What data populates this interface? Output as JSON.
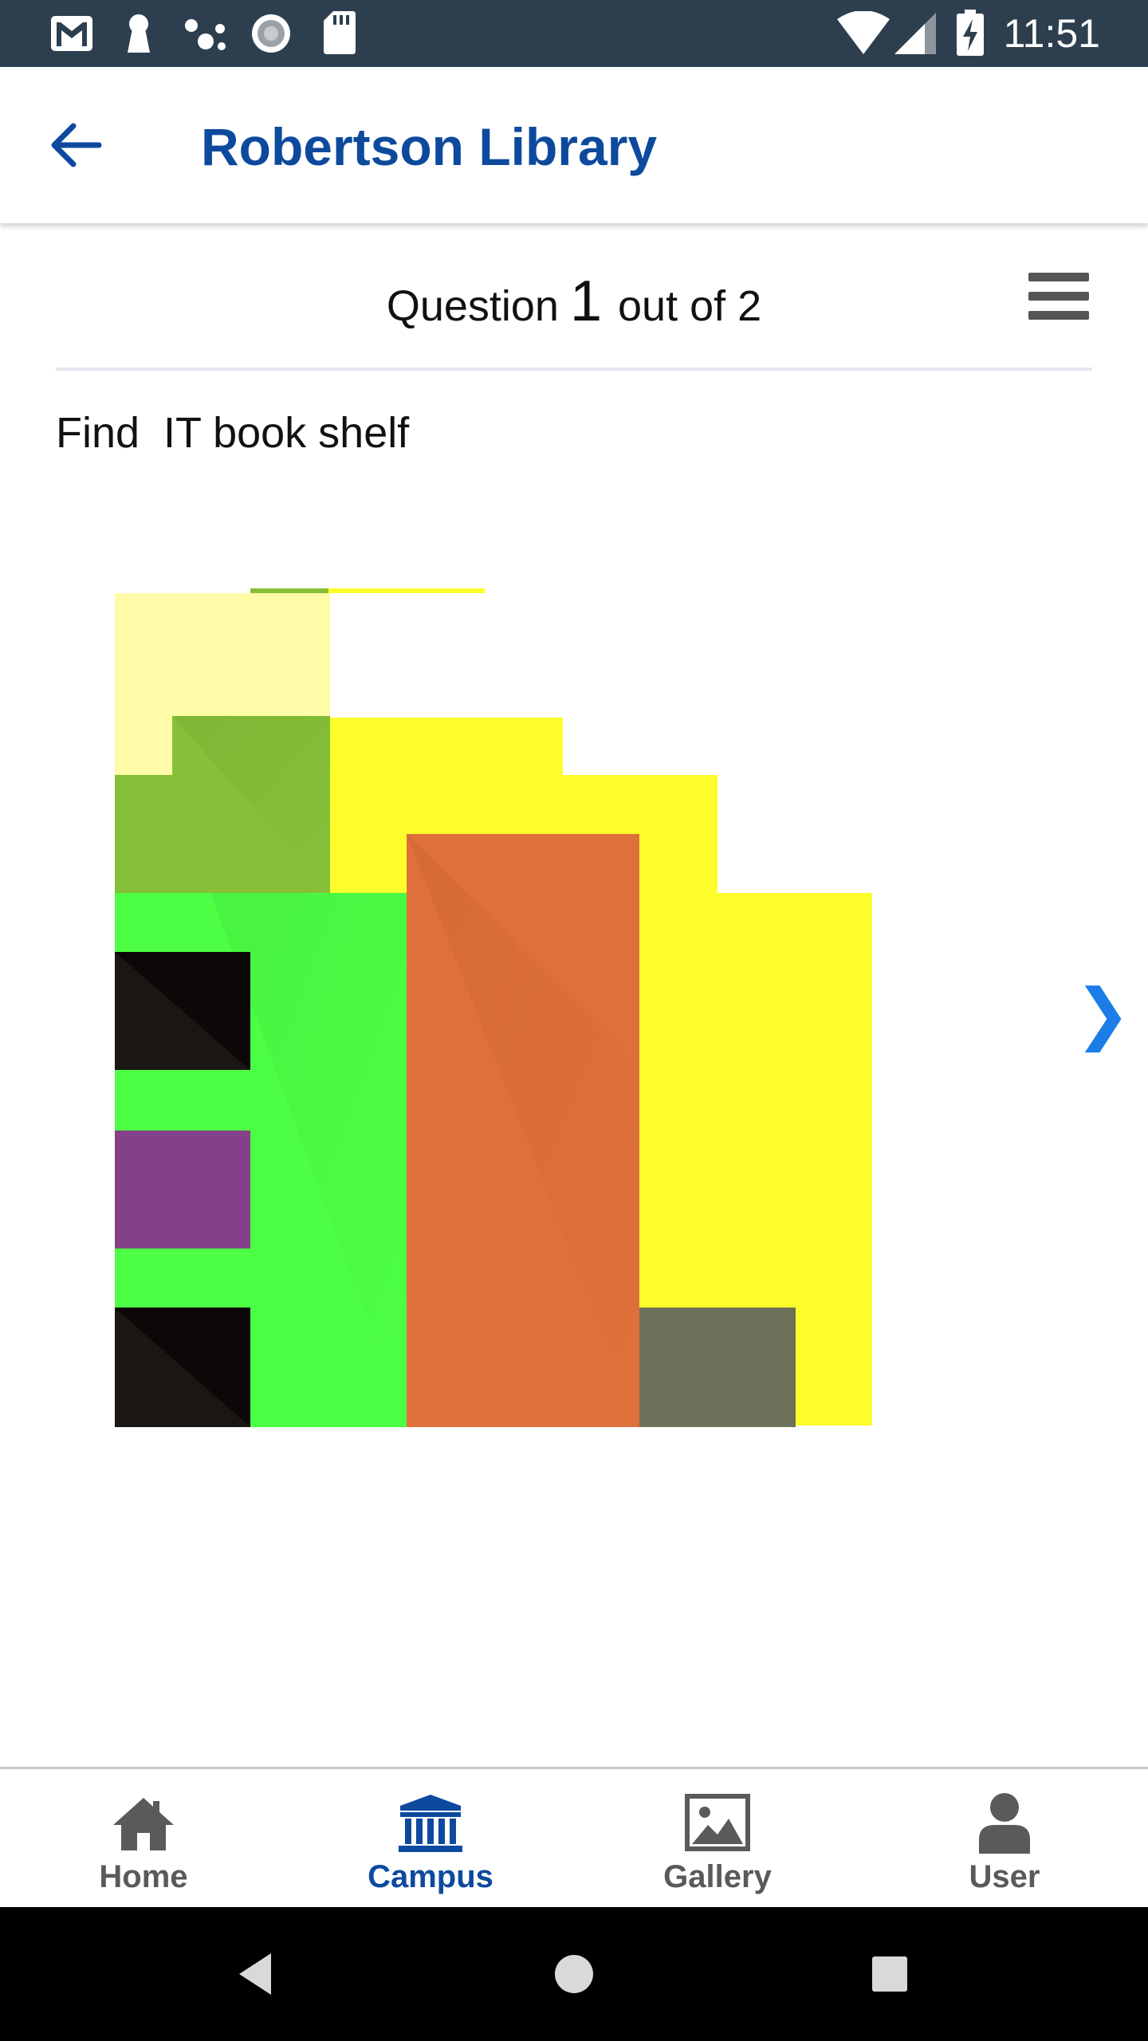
{
  "status_bar": {
    "time": "11:51",
    "icons": [
      "gmail-icon",
      "keyhole-icon",
      "assistant-dots-icon",
      "sync-icon",
      "sd-card-icon",
      "wifi-icon",
      "signal-icon",
      "battery-charging-icon"
    ]
  },
  "app_bar": {
    "title": "Robertson Library",
    "back_icon": "back-arrow-icon",
    "title_color": "#0d4a9e"
  },
  "question": {
    "label": "Question",
    "number": "1",
    "out_of": "out of 2",
    "menu_icon": "hamburger-menu-icon"
  },
  "instruction": "Find  IT book shelf",
  "map": {
    "next_icon": "chevron-right-icon",
    "next_glyph": "❯",
    "zone_colors": [
      "#fffba8",
      "#86c038",
      "#fdfd2c",
      "#4cff44",
      "#e07039",
      "#0c0807",
      "#844189",
      "#6d7159"
    ]
  },
  "bottom_nav": {
    "items": [
      {
        "label": "Home",
        "icon": "home-icon",
        "active": false
      },
      {
        "label": "Campus",
        "icon": "campus-building-icon",
        "active": true
      },
      {
        "label": "Gallery",
        "icon": "gallery-image-icon",
        "active": false
      },
      {
        "label": "User",
        "icon": "user-icon",
        "active": false
      }
    ],
    "active_color": "#0d4a9e",
    "inactive_color": "#5a5a5a"
  },
  "system_nav": {
    "icons": [
      "back-triangle-icon",
      "home-circle-icon",
      "recents-square-icon"
    ]
  }
}
